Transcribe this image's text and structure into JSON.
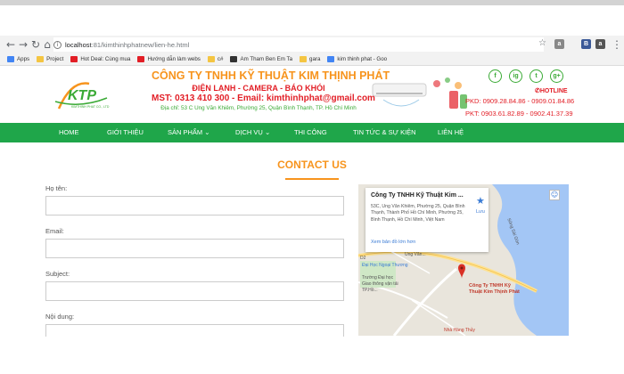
{
  "browser": {
    "url_host": "localhost",
    "url_path": ":81/kimthinhphatnew/lien-he.html",
    "extensions": [
      "a",
      "B",
      "a"
    ],
    "bookmarks": [
      {
        "label": "Apps",
        "color": "#4285f4"
      },
      {
        "label": "Project",
        "color": "#f4c542"
      },
      {
        "label": "Hot Deal: Cùng mua",
        "color": "#e21e26"
      },
      {
        "label": "Hướng dẫn làm webs",
        "color": "#e21e26"
      },
      {
        "label": "c#",
        "color": "#f4c542"
      },
      {
        "label": "Am Tham Ben Em Ta",
        "color": "#333333"
      },
      {
        "label": "gara",
        "color": "#f4c542"
      },
      {
        "label": "kim thinh phat - Goo",
        "color": "#4285f4"
      }
    ]
  },
  "header": {
    "logo_text": "KTP",
    "logo_subtext": "KIMTHINH PHAT CO., LTD",
    "company_name": "CÔNG TY TNHH KỸ THUẬT KIM THỊNH PHÁT",
    "services": "ĐIỆN LẠNH - CAMERA - BÁO KHÓI",
    "mst": "MST: 0313 410 300 - Email: kimthinhphat@gmail.com",
    "address": "Địa chỉ: 53 C Ung Văn Khiêm, Phường 25, Quận Bình Thạnh, TP. Hồ Chí Minh",
    "hotline_label": "HOTLINE",
    "pkd": "PKD: 0909.28.84.86 - 0909.01.84.86",
    "pkt": "PKT: 0903.61.82.89 - 0902.41.37.39",
    "socials": [
      "f",
      "ig",
      "t",
      "g+"
    ]
  },
  "nav": {
    "items": [
      {
        "label": "HOME",
        "dropdown": false
      },
      {
        "label": "GIỚI THIỆU",
        "dropdown": false
      },
      {
        "label": "SẢN PHẨM",
        "dropdown": true
      },
      {
        "label": "DỊCH VỤ",
        "dropdown": true
      },
      {
        "label": "THI CÔNG",
        "dropdown": false
      },
      {
        "label": "TIN TỨC & SỰ KIỆN",
        "dropdown": false
      },
      {
        "label": "LIÊN HỆ",
        "dropdown": false
      }
    ]
  },
  "contact": {
    "title": "CONTACT US",
    "fields": [
      {
        "label": "Họ tên:",
        "value": ""
      },
      {
        "label": "Email:",
        "value": ""
      },
      {
        "label": "Subject:",
        "value": ""
      },
      {
        "label": "Nội dung:",
        "value": ""
      }
    ]
  },
  "map": {
    "card_title": "Công Ty TNHH Kỹ Thuật Kim ...",
    "card_address": "53C, Ung Văn Khiêm, Phường 25, Quận Bình Thạnh, Thành Phố Hồ Chí Minh, Phường 25, Bình Thạnh, Hồ Chí Minh, Việt Nam",
    "card_link": "Xem bản đồ lớn hơn",
    "save_label": "Lưu",
    "pin_label": "Công Ty TNHH Kỹ Thuật Kim Thịnh Phát",
    "labels": {
      "river": "Sông Sài Gòn",
      "street": "Ung Văn...",
      "school": "Đại Học Ngoại Thương",
      "d2": "D2",
      "school2": "Trường Đại học Giao thông vận tải TP.Hồ...",
      "nha_hang": "Nhà Hàng Thủy"
    }
  }
}
